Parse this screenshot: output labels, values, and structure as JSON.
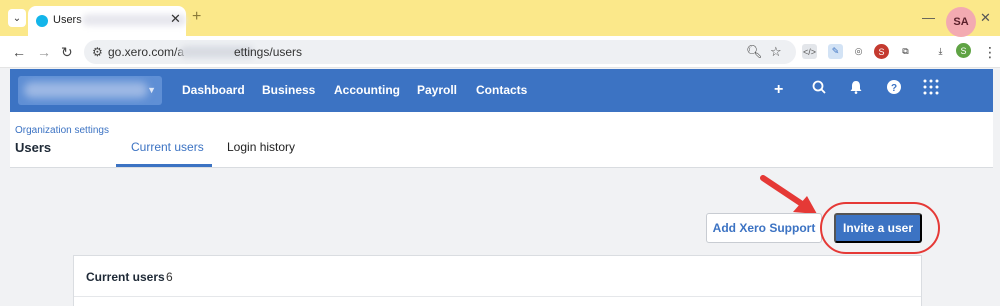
{
  "browser": {
    "tab": {
      "title": "Users",
      "close": "✕",
      "favicon": "xero-favicon"
    },
    "new_tab": "+",
    "controls": {
      "minimize": "—",
      "maximize": "☐",
      "close": "✕",
      "menu": "⌄"
    },
    "address": {
      "url_start": "go.xero.com/a",
      "url_end": "ettings/users"
    },
    "icons": [
      "back-icon",
      "forward-icon",
      "reload-icon",
      "site-settings-icon",
      "zoom-icon",
      "bookmark-star-icon",
      "extensions-icon",
      "download-icon",
      "profile-icon",
      "more-icon"
    ],
    "profile_initial": "S"
  },
  "xero_nav": {
    "items": [
      "Dashboard",
      "Business",
      "Accounting",
      "Payroll",
      "Contacts"
    ],
    "right_icons": [
      "add-icon",
      "search-icon",
      "bell-icon",
      "help-icon",
      "apps-grid-icon"
    ],
    "avatar": "SA"
  },
  "page": {
    "breadcrumb": "Organization settings",
    "title": "Users",
    "tabs": [
      {
        "label": "Current users",
        "active": true
      },
      {
        "label": "Login history",
        "active": false
      }
    ]
  },
  "actions": {
    "add_support": "Add Xero Support",
    "invite": "Invite a user"
  },
  "users_card": {
    "title": "Current users",
    "count": "6"
  },
  "colors": {
    "brand": "#3c73c3",
    "annotation": "#e53936",
    "tabstrip": "#fbe88a"
  }
}
